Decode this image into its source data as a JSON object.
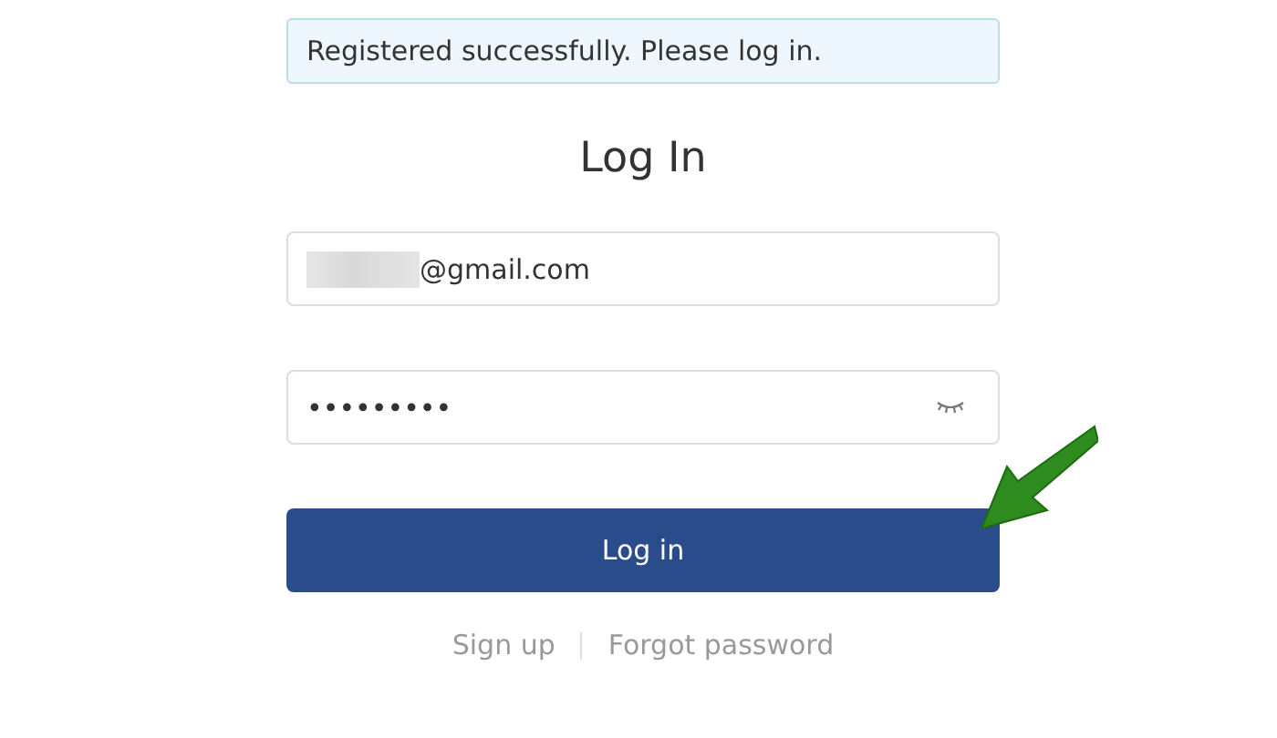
{
  "alert": {
    "message": "Registered successfully. Please log in."
  },
  "title": "Log In",
  "fields": [
    {
      "kind": "email",
      "value": "@gmail.com",
      "redacted": true
    },
    {
      "kind": "password",
      "value": "•••••••••",
      "redacted": false
    }
  ],
  "submit_button": "Log in",
  "links": [
    {
      "label": "Sign up"
    },
    {
      "label": "Forgot password"
    }
  ],
  "annotation": {
    "kind": "arrow"
  }
}
